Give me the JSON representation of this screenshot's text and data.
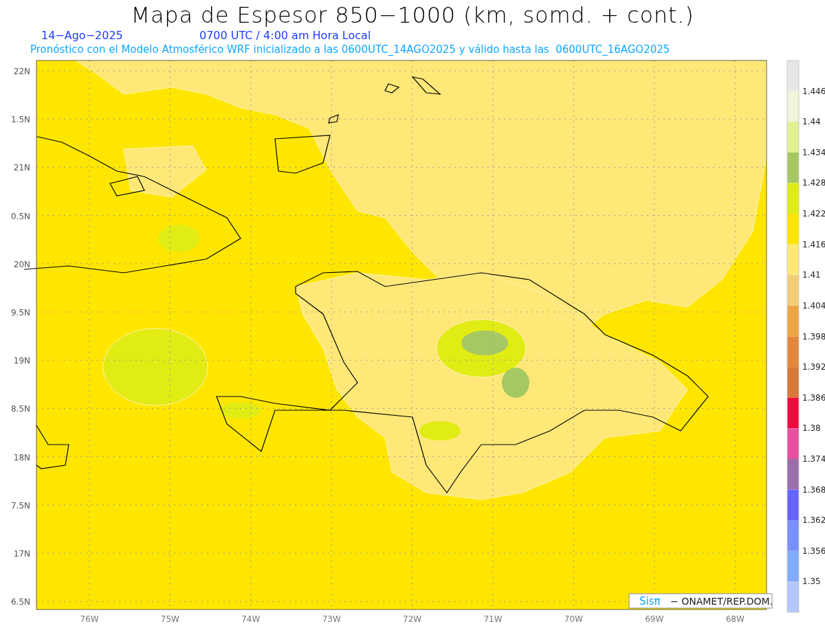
{
  "title": "Mapa de Espesor 850−1000 (km, somd. + cont.)",
  "date": "14−Ago−2025",
  "time": "0700 UTC / 4:00 am Hora Local",
  "forecast_note": "Pronóstico con el Modelo Atmosférico WRF inicializado a las 0600UTC_14AGO2025 y válido hasta las  0600UTC_16AGO2025",
  "latitude_labels": [
    "22N",
    "1.5N",
    "21N",
    "0.5N",
    "20N",
    "9.5N",
    "19N",
    "8.5N",
    "18N",
    "7.5N",
    "17N",
    "6.5N"
  ],
  "longitude_labels": [
    "76W",
    "75W",
    "74W",
    "73W",
    "72W",
    "71W",
    "70W",
    "69W",
    "68W"
  ],
  "credit": {
    "logo": "Sisπ",
    "text": "− ONAMET/REP.DOM."
  },
  "colorbar": [
    {
      "color": "#e6e6e6",
      "label": "1.446"
    },
    {
      "color": "#eef5d8",
      "label": "1.44"
    },
    {
      "color": "#e2f094",
      "label": "1.434"
    },
    {
      "color": "#a6c864",
      "label": "1.428"
    },
    {
      "color": "#e1eb14",
      "label": "1.422"
    },
    {
      "color": "#ffe600",
      "label": "1.416"
    },
    {
      "color": "#ffe878",
      "label": "1.41"
    },
    {
      "color": "#f2cd78",
      "label": "1.404"
    },
    {
      "color": "#eca546",
      "label": "1.398"
    },
    {
      "color": "#e4873c",
      "label": "1.392"
    },
    {
      "color": "#d8783a",
      "label": "1.386"
    },
    {
      "color": "#ee0a3c",
      "label": "1.38"
    },
    {
      "color": "#e650a0",
      "label": "1.374"
    },
    {
      "color": "#9a6eaa",
      "label": "1.368"
    },
    {
      "color": "#6464f8",
      "label": "1.362"
    },
    {
      "color": "#7890fa",
      "label": "1.356"
    },
    {
      "color": "#82aaff",
      "label": "1.35"
    },
    {
      "color": "#b4c8ff"
    }
  ]
}
